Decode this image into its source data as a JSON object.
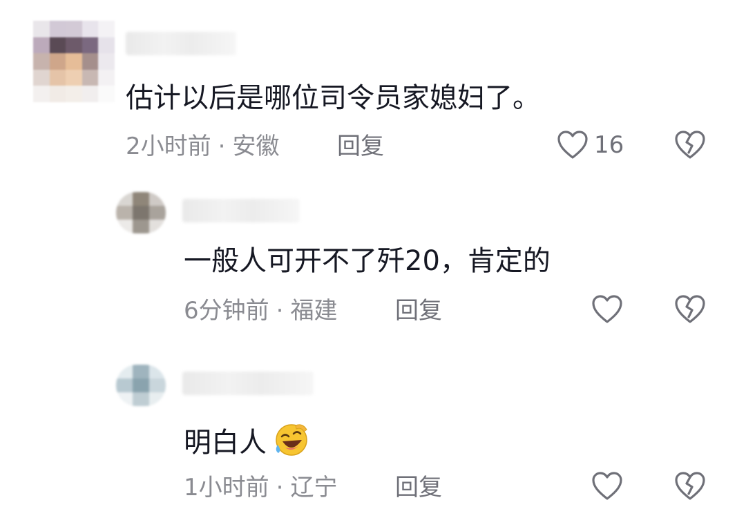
{
  "colors": {
    "text": "#161823",
    "meta": "#8a8b91",
    "icon": "#6f7078"
  },
  "comments": [
    {
      "text": "估计以后是哪位司令员家媳妇了。",
      "time": "2小时前",
      "separator": "·",
      "location": "安徽",
      "reply_label": "回复",
      "like_count": "16"
    },
    {
      "text": "一般人可开不了歼20，肯定的",
      "time": "6分钟前",
      "separator": "·",
      "location": "福建",
      "reply_label": "回复",
      "like_count": ""
    },
    {
      "text": "明白人",
      "emoji": "rolling-on-floor-laughing-emoji",
      "time": "1小时前",
      "separator": "·",
      "location": "辽宁",
      "reply_label": "回复",
      "like_count": ""
    }
  ],
  "icons": {
    "like": "heart-outline-icon",
    "dislike": "broken-heart-icon"
  }
}
